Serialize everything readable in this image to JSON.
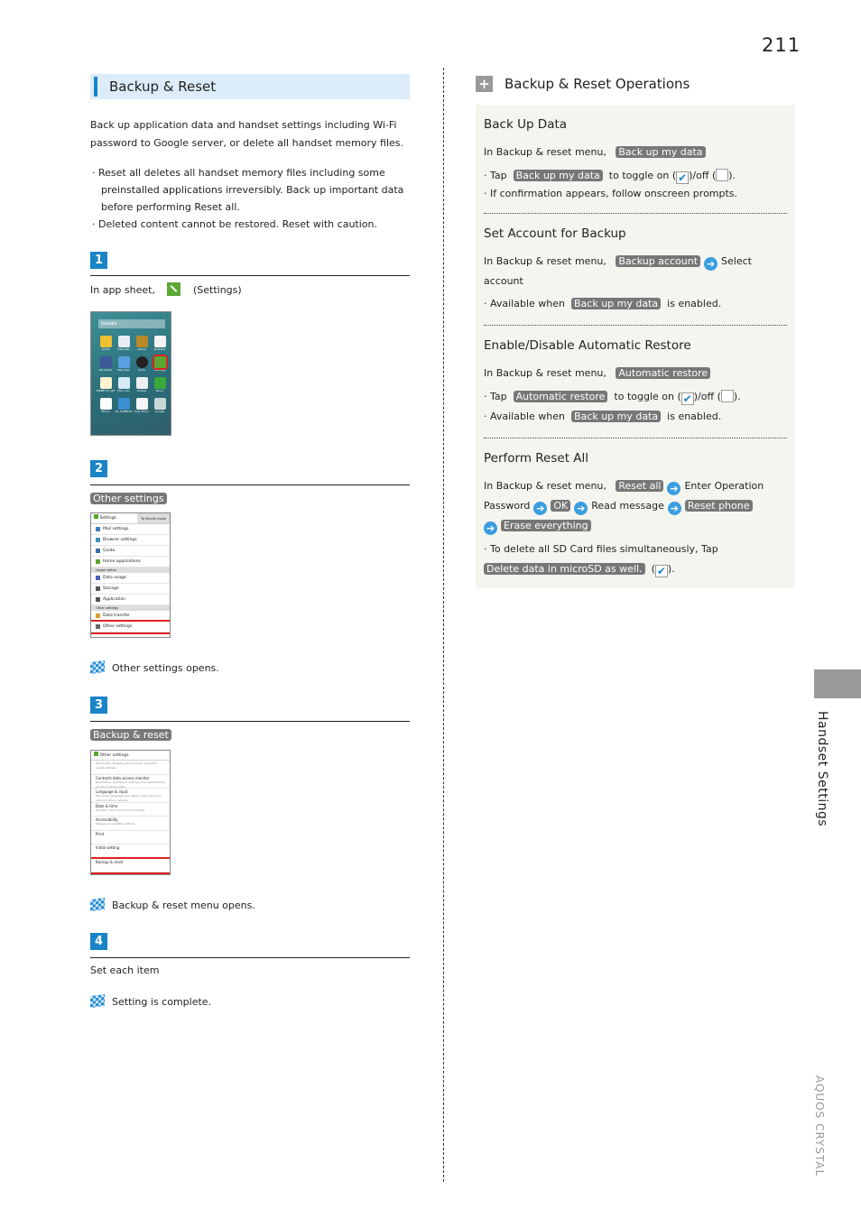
{
  "page_number": "211",
  "section": {
    "title": "Backup & Reset",
    "intro": "Back up application data and handset settings including Wi-Fi password to Google server, or delete all handset memory files.",
    "notes": [
      "Reset all deletes all handset memory files including some preinstalled applications irreversibly. Back up important data before performing Reset all.",
      "Deleted content cannot be restored. Reset with caution."
    ]
  },
  "steps": [
    {
      "num": "1",
      "text_before": "In app sheet,",
      "text_after": "(Settings)",
      "icon": "settings-icon"
    },
    {
      "num": "2",
      "chip": "Other settings",
      "result": "Other settings opens."
    },
    {
      "num": "3",
      "chip": "Backup & reset",
      "result": "Backup & reset menu opens."
    },
    {
      "num": "4",
      "text": "Set each item",
      "result": "Setting is complete."
    }
  ],
  "screenshot1": {
    "search_label": "Google",
    "apps": [
      "Gmail",
      "Calendar",
      "Album",
      "Notepad",
      "Facebook",
      "Map Pass",
      "Clock",
      "Settings",
      "PRIME for CM",
      "FM++CC",
      "Lookup",
      "Music",
      "Yahoo!",
      "My SoftBank",
      "Play Store",
      "Google"
    ],
    "highlight": "Settings"
  },
  "screenshot2": {
    "title": "Settings",
    "mode_button": "To Simple mode",
    "items": [
      {
        "type": "item",
        "label": "Mail settings"
      },
      {
        "type": "item",
        "label": "Browser settings"
      },
      {
        "type": "item",
        "label": "Guide"
      },
      {
        "type": "item",
        "label": "Home applications"
      },
      {
        "type": "header",
        "label": "Usage status"
      },
      {
        "type": "item",
        "label": "Data usage"
      },
      {
        "type": "item",
        "label": "Storage"
      },
      {
        "type": "item",
        "label": "Application"
      },
      {
        "type": "header",
        "label": "Other settings"
      },
      {
        "type": "item",
        "label": "Data transfer"
      },
      {
        "type": "item",
        "label": "Other settings",
        "highlight": true
      }
    ]
  },
  "screenshot3": {
    "title": "Other settings",
    "items": [
      {
        "label": "",
        "sub": "Temporarily disabling secret mode, and other secret settings."
      },
      {
        "label": "Contacts data access monitor",
        "sub": "Notification, permission settings when applications access Contacts data."
      },
      {
        "label": "Language & input",
        "sub": "Set locale (language and region), text input and auto-correction options."
      },
      {
        "label": "Date & time",
        "sub": "Set date, time, time zone & formats."
      },
      {
        "label": "Accessibility",
        "sub": "Manage accessibility options."
      },
      {
        "label": "Print",
        "sub": ""
      },
      {
        "label": "Initial setting",
        "sub": ""
      },
      {
        "label": "Backup & reset",
        "sub": "",
        "highlight": true
      }
    ]
  },
  "operations": {
    "title": "Backup & Reset Operations",
    "blocks": [
      {
        "heading": "Back Up Data",
        "line": {
          "text": "In Backup & reset menu,",
          "chip": "Back up my data"
        },
        "bullets": [
          {
            "pre": "Tap",
            "chip": "Back up my data",
            "post": "to toggle on (",
            "mid": ")/off (",
            "end": ")."
          },
          {
            "text": "If confirmation appears, follow onscreen prompts."
          }
        ]
      },
      {
        "heading": "Set Account for Backup",
        "line": {
          "text": "In Backup & reset menu,",
          "chip": "Backup account",
          "after": "Select account"
        },
        "bullets": [
          {
            "pre": "Available when",
            "chip": "Back up my data",
            "post": "is enabled."
          }
        ]
      },
      {
        "heading": "Enable/Disable Automatic Restore",
        "line": {
          "text": "In Backup & reset menu,",
          "chip": "Automatic restore"
        },
        "bullets": [
          {
            "pre": "Tap",
            "chip": "Automatic restore",
            "post": "to toggle on (",
            "mid": ")/off (",
            "end": ")."
          },
          {
            "pre": "Available when",
            "chip": "Back up my data",
            "post": "is enabled."
          }
        ]
      },
      {
        "heading": "Perform Reset All",
        "line": {
          "text": "In Backup & reset menu,",
          "chip1": "Reset all",
          "t2": "Enter Operation Password",
          "chip2": "OK",
          "t3": "Read message",
          "chip3": "Reset phone",
          "chip4": "Erase everything"
        },
        "bullets": [
          {
            "pre": "To delete all SD Card files simultaneously, Tap",
            "chip": "Delete data in microSD as well.",
            "post": "(",
            "end": ")."
          }
        ]
      }
    ]
  },
  "side_tab": {
    "label": "Handset Settings",
    "brand": "AQUOS CRYSTAL"
  },
  "colors": {
    "accent": "#1a84c7",
    "chip": "#777777",
    "arrow": "#3a9ee0",
    "box": "#f5f5f0",
    "title_bg": "#dcecf8"
  }
}
